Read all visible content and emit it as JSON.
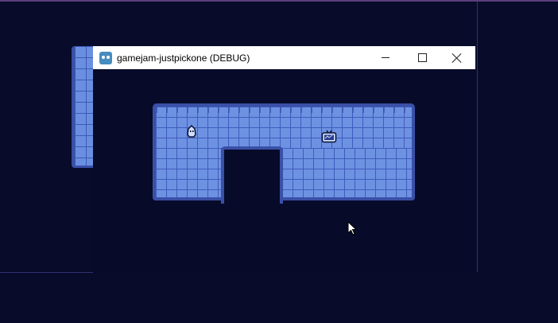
{
  "window": {
    "title": "gamejam-justpickone (DEBUG)",
    "app_icon": "godot-engine-icon",
    "controls": [
      "minimize-icon",
      "maximize-icon",
      "close-icon"
    ]
  },
  "game": {
    "sprites": [
      "player-character-icon",
      "tv-monitor-icon"
    ],
    "colors": {
      "background": "#070b29",
      "floor": "#6e92e2",
      "wall": "#3a50a8"
    }
  },
  "cursor": "mouse-pointer-icon"
}
